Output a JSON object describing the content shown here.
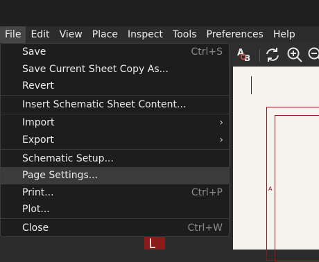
{
  "menubar": {
    "items": [
      "File",
      "Edit",
      "View",
      "Place",
      "Inspect",
      "Tools",
      "Preferences",
      "Help"
    ]
  },
  "toolbar": {
    "icons": [
      "text-style-icon",
      "refresh-icon",
      "zoom-in-icon",
      "zoom-out-icon"
    ],
    "text_style_label": "AB"
  },
  "canvas": {
    "border_letter": "A"
  },
  "file_menu": {
    "save": {
      "label": "Save",
      "shortcut": "Ctrl+S"
    },
    "save_copy": {
      "label": "Save Current Sheet Copy As..."
    },
    "revert": {
      "label": "Revert"
    },
    "insert_sheet": {
      "label": "Insert Schematic Sheet Content..."
    },
    "import": {
      "label": "Import"
    },
    "export": {
      "label": "Export"
    },
    "schematic_setup": {
      "label": "Schematic Setup..."
    },
    "page_settings": {
      "label": "Page Settings..."
    },
    "print": {
      "label": "Print...",
      "shortcut": "Ctrl+P"
    },
    "plot": {
      "label": "Plot..."
    },
    "close": {
      "label": "Close",
      "shortcut": "Ctrl+W"
    },
    "submenu_arrow": "›"
  },
  "colors": {
    "menu_background": "#1d1d1d",
    "highlight": "#3b3b3b",
    "schematic_border": "#8b1a1a",
    "canvas": "#f5f4ef"
  }
}
